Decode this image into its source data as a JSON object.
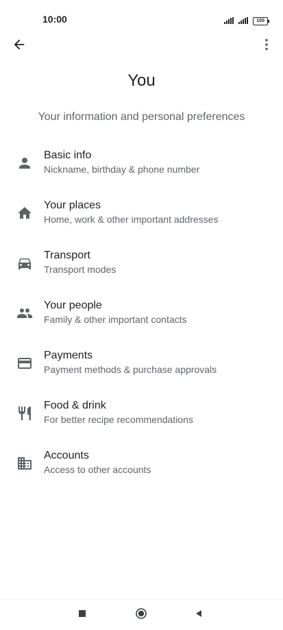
{
  "status_bar": {
    "time": "10:00",
    "battery": "100",
    "icons": [
      "signal-icon",
      "signal-icon",
      "battery-icon"
    ]
  },
  "top_bar": {
    "back_icon": "arrow-back-icon",
    "more_icon": "more-vert-icon"
  },
  "header": {
    "title": "You",
    "subtitle": "Your information and personal preferences"
  },
  "menu": {
    "items": [
      {
        "icon": "person-icon",
        "label": "Basic info",
        "description": "Nickname, birthday & phone number"
      },
      {
        "icon": "home-icon",
        "label": "Your places",
        "description": "Home, work & other important addresses"
      },
      {
        "icon": "car-icon",
        "label": "Transport",
        "description": "Transport modes"
      },
      {
        "icon": "people-icon",
        "label": "Your people",
        "description": "Family & other important contacts"
      },
      {
        "icon": "credit-card-icon",
        "label": "Payments",
        "description": "Payment methods & purchase approvals"
      },
      {
        "icon": "restaurant-icon",
        "label": "Food & drink",
        "description": "For better recipe recommendations"
      },
      {
        "icon": "business-icon",
        "label": "Accounts",
        "description": "Access to other accounts"
      }
    ]
  },
  "nav_bar": {
    "icons": [
      "recents-icon",
      "home-icon",
      "back-icon"
    ]
  },
  "colors": {
    "text_primary": "#202124",
    "text_secondary": "#5f6368",
    "icon": "#5f6368",
    "background": "#ffffff"
  }
}
